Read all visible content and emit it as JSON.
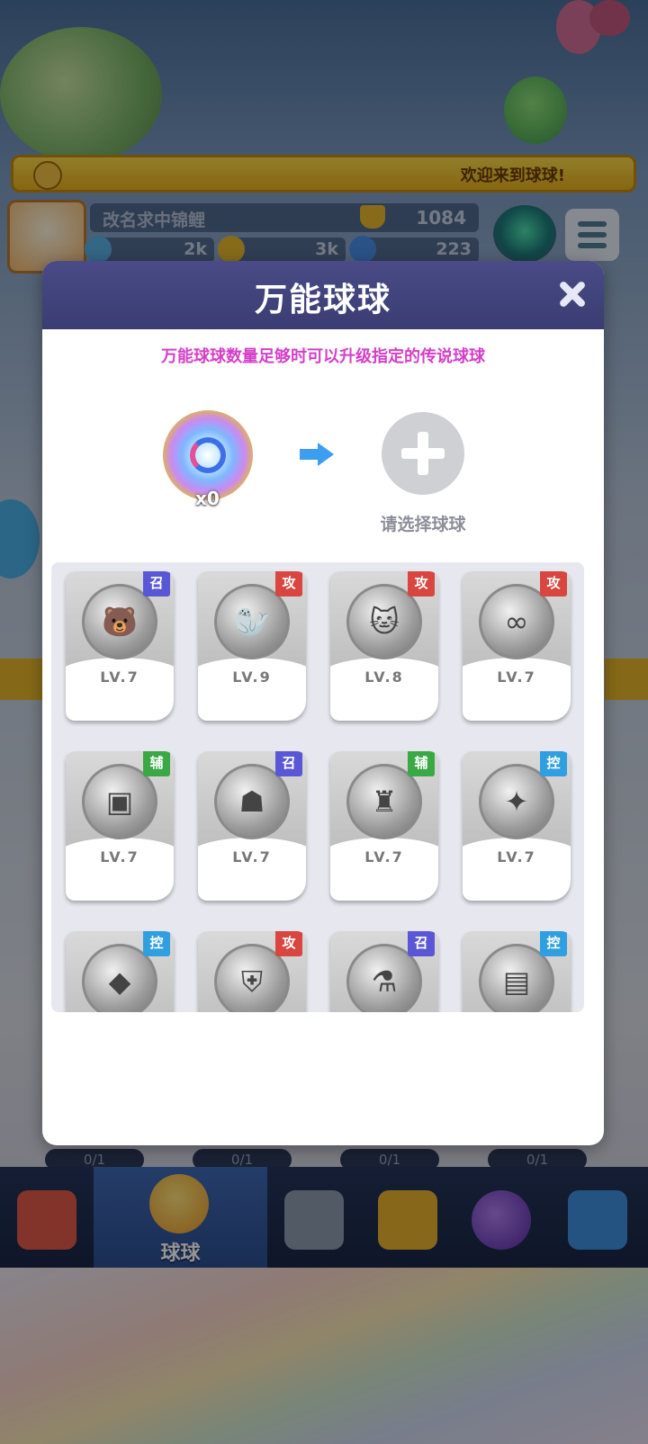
{
  "background": {
    "welcome_text": "欢迎来到球球!",
    "player_name": "改名求中锦鲤",
    "trophy_value": "1084",
    "resources": [
      "2k",
      "3k",
      "223"
    ],
    "card_counters": [
      "0/1",
      "0/1",
      "0/1",
      "0/1"
    ]
  },
  "bottom_nav": {
    "active_label": "球球"
  },
  "modal": {
    "title": "万能球球",
    "hint": "万能球球数量足够时可以升级指定的传说球球",
    "wild_count": "x0",
    "select_label": "请选择球球"
  },
  "colors": {
    "tag_summon": "#5a57d6",
    "tag_attack": "#d9453f",
    "tag_support": "#3aa845",
    "tag_control": "#2f9fe0",
    "hint_text": "#d43fc8",
    "header": "#3e3f78"
  },
  "balls": [
    {
      "tag": "召",
      "tag_type": "summon",
      "level": "LV.7",
      "icon": "bear-icon"
    },
    {
      "tag": "攻",
      "tag_type": "attack",
      "level": "LV.9",
      "icon": "seal-icon"
    },
    {
      "tag": "攻",
      "tag_type": "attack",
      "level": "LV.8",
      "icon": "cat-icon"
    },
    {
      "tag": "攻",
      "tag_type": "attack",
      "level": "LV.7",
      "icon": "infinity-icon"
    },
    {
      "tag": "辅",
      "tag_type": "support",
      "level": "LV.7",
      "icon": "shield-card-icon"
    },
    {
      "tag": "召",
      "tag_type": "summon",
      "level": "LV.7",
      "icon": "hooded-figure-icon"
    },
    {
      "tag": "辅",
      "tag_type": "support",
      "level": "LV.7",
      "icon": "winged-helm-icon"
    },
    {
      "tag": "控",
      "tag_type": "control",
      "level": "LV.7",
      "icon": "sparkle-icon"
    },
    {
      "tag": "控",
      "tag_type": "control",
      "level": "",
      "icon": "crystal-icon"
    },
    {
      "tag": "攻",
      "tag_type": "attack",
      "level": "",
      "icon": "armor-icon"
    },
    {
      "tag": "召",
      "tag_type": "summon",
      "level": "",
      "icon": "potion-icon"
    },
    {
      "tag": "控",
      "tag_type": "control",
      "level": "",
      "icon": "book-icon"
    }
  ]
}
